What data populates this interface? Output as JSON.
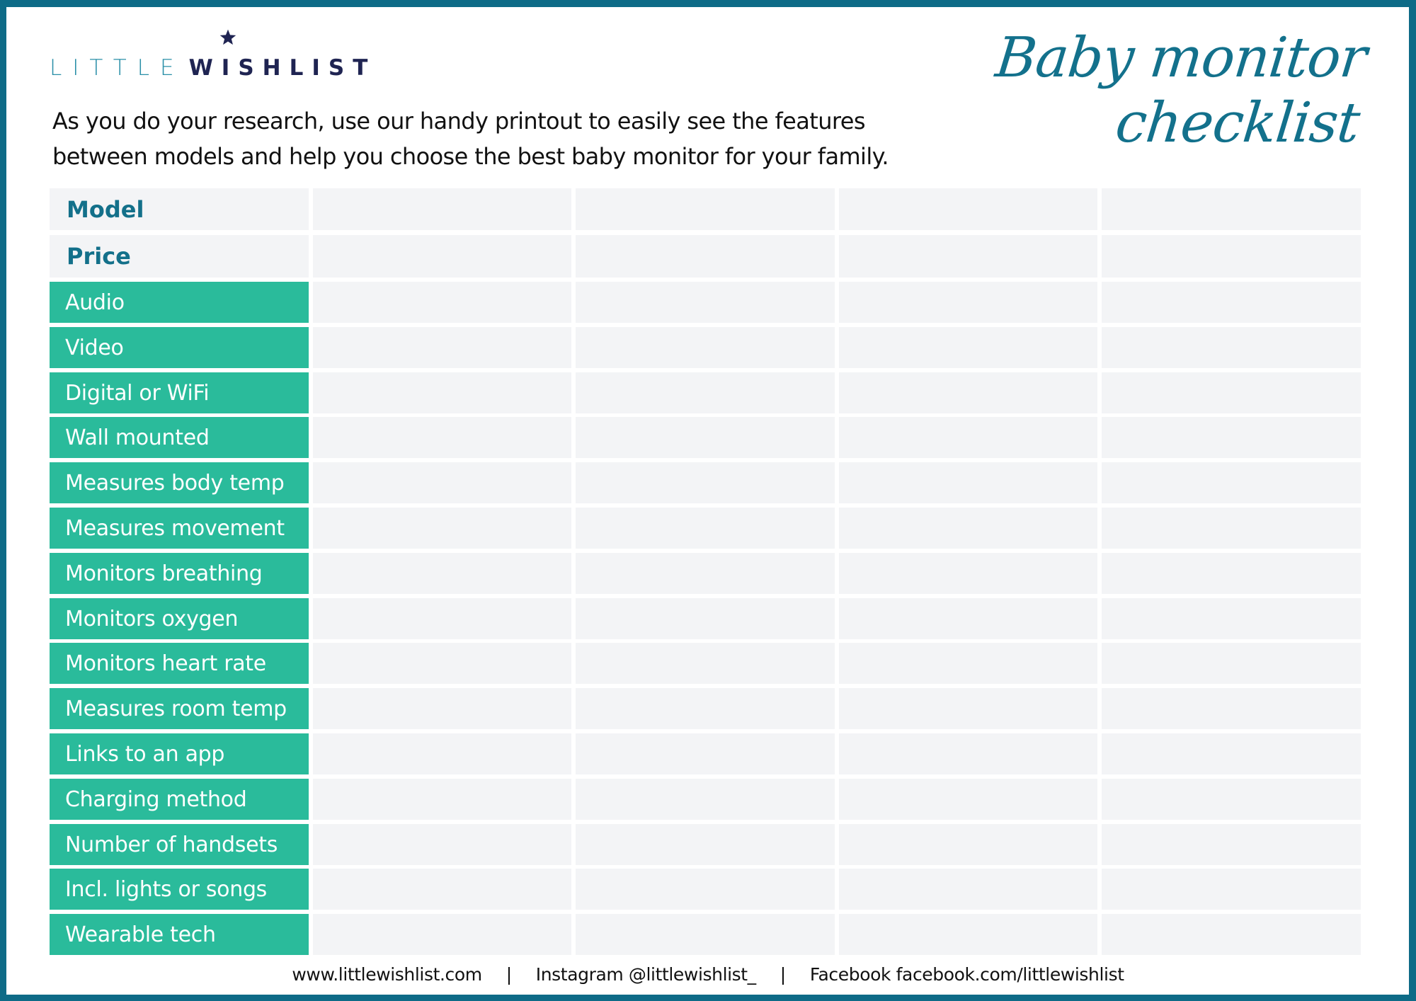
{
  "brand": {
    "logo_light": "LITTLE",
    "logo_bold": "WISHLIST",
    "logo_icon": "star-icon"
  },
  "title": {
    "line1": "Baby monitor",
    "line2": "checklist"
  },
  "intro": {
    "line1": "As you do your research, use our handy printout to easily see the features",
    "line2": "between models and help you choose the best baby monitor for your family."
  },
  "table": {
    "blank_columns": 4,
    "header_rows": [
      "Model",
      "Price"
    ],
    "feature_rows": [
      "Audio",
      "Video",
      "Digital or WiFi",
      "Wall mounted",
      "Measures body temp",
      "Measures movement",
      "Monitors breathing",
      "Monitors oxygen",
      "Monitors heart rate",
      "Measures room temp",
      "Links to an app",
      "Charging method",
      "Number of handsets",
      "Incl. lights or songs",
      "Wearable tech"
    ]
  },
  "footer": {
    "website": "www.littlewishlist.com",
    "separator": "|",
    "instagram": "Instagram @littlewishlist_",
    "facebook": "Facebook facebook.com/littlewishlist"
  },
  "colors": {
    "frame": "#0E6B87",
    "feature_green": "#2ABB9B",
    "cell_gray": "#F3F4F6",
    "header_teal": "#13708A",
    "logo_navy": "#1F2452",
    "logo_teal": "#2A8FA8"
  }
}
